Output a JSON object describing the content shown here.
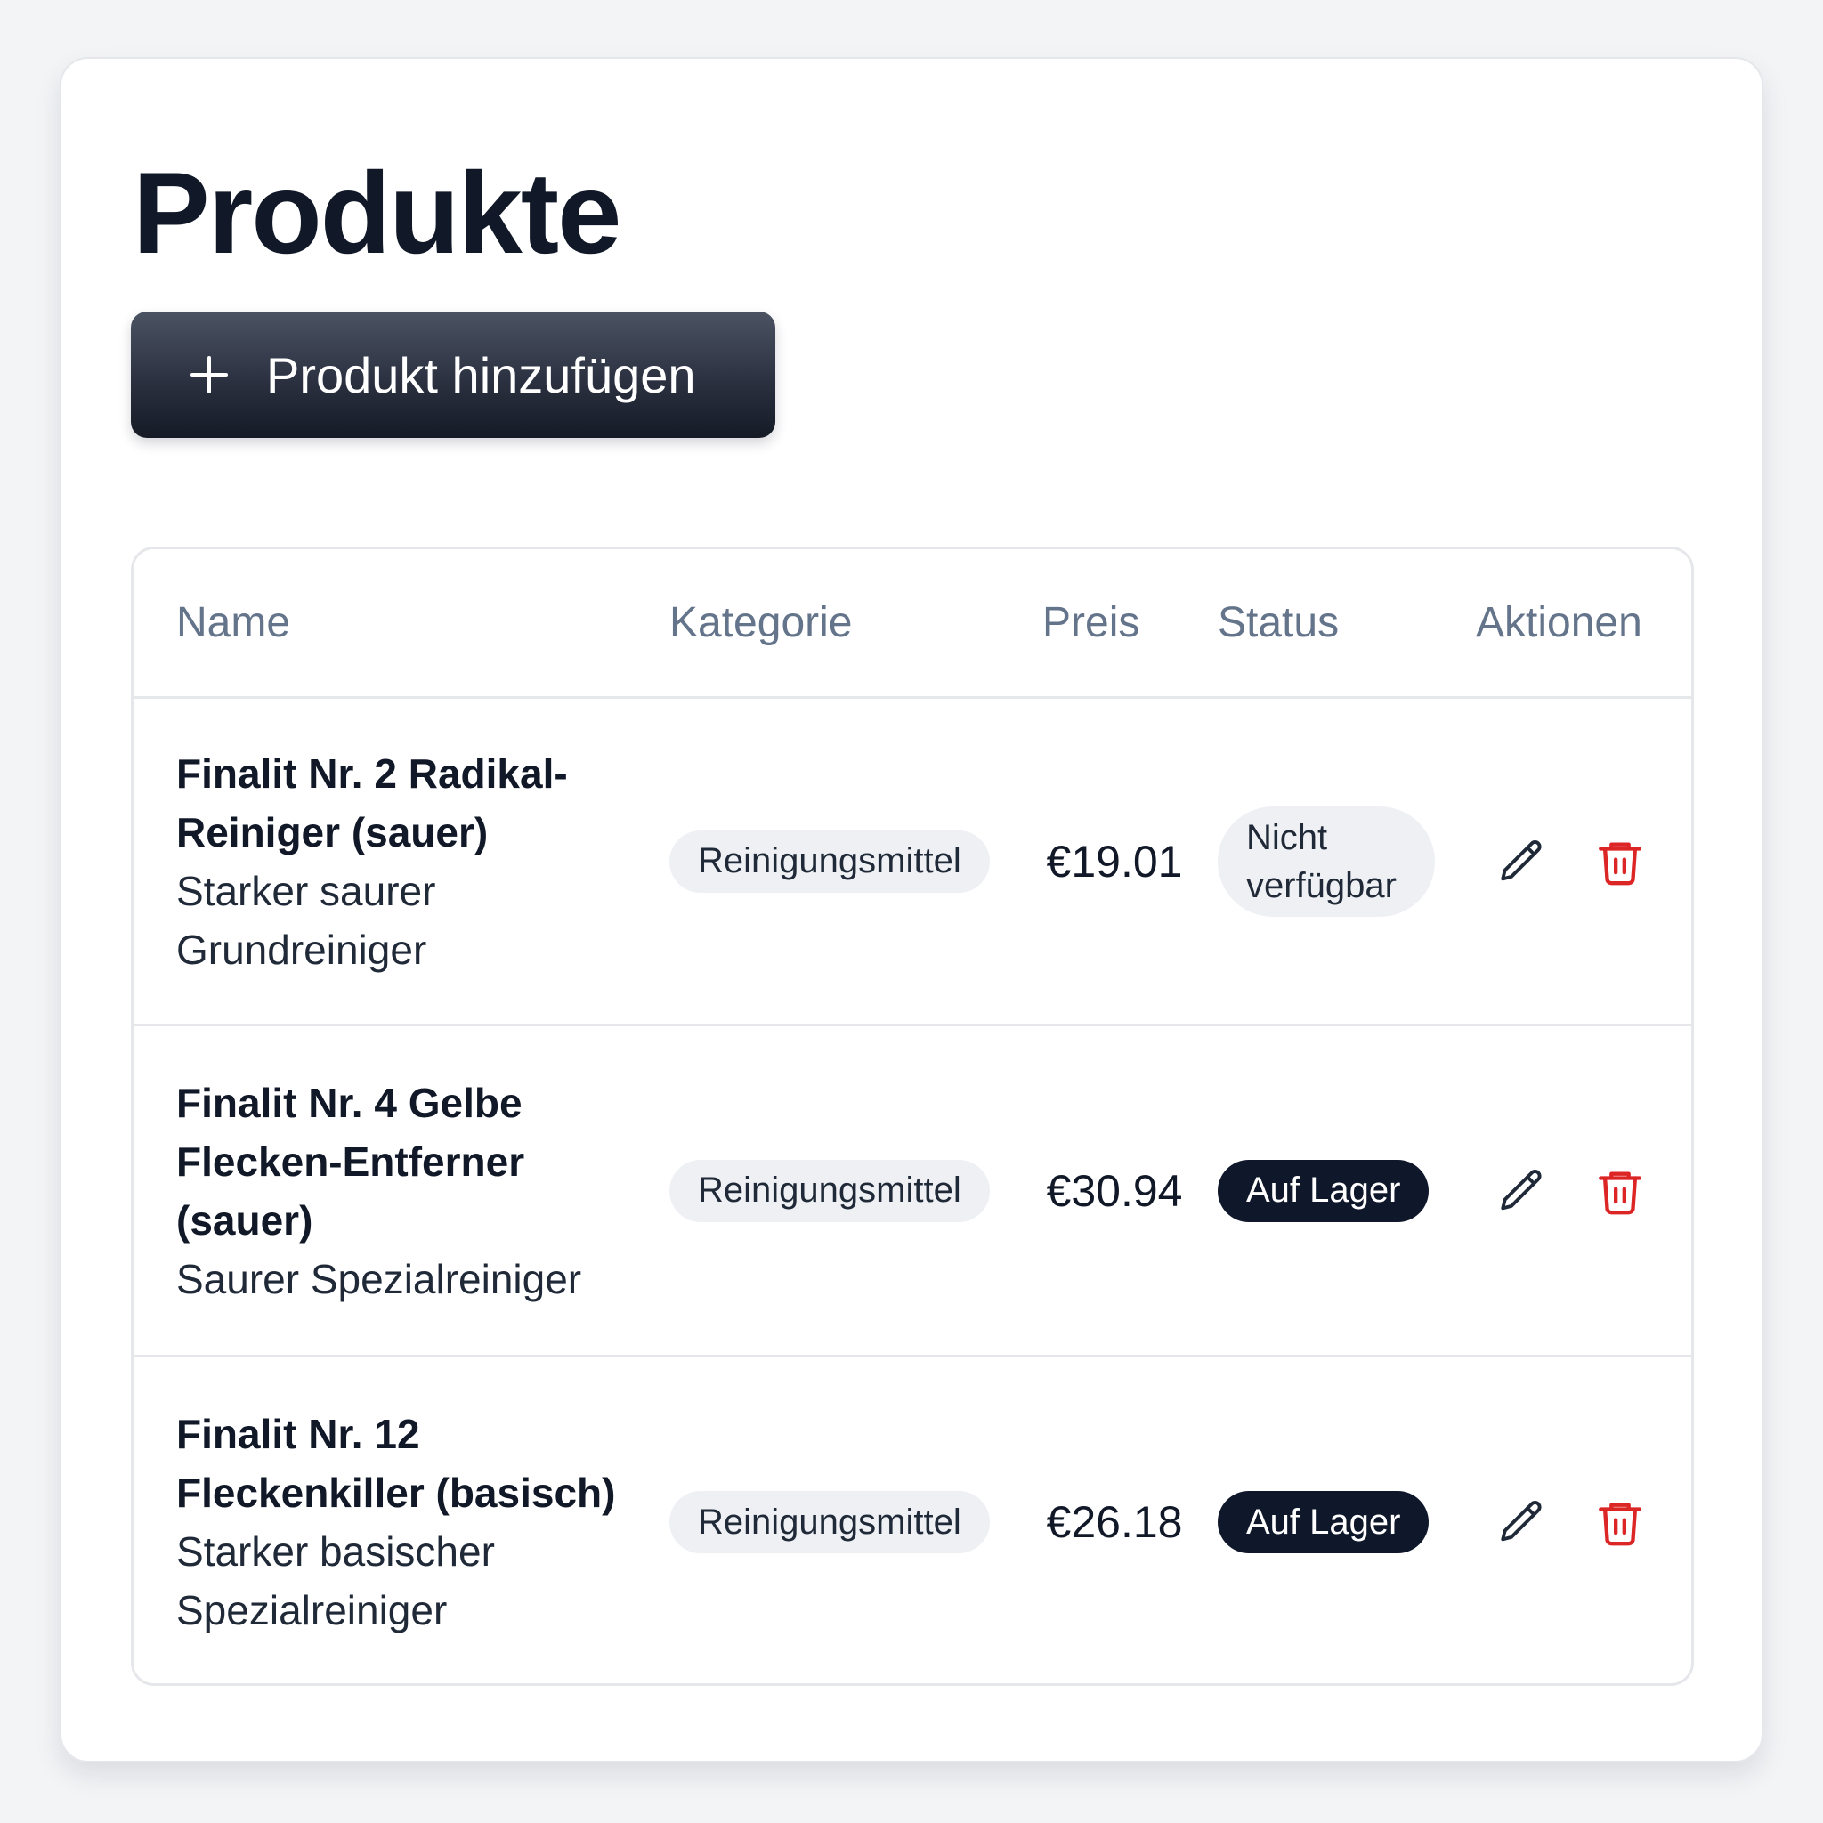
{
  "page": {
    "title": "Produkte"
  },
  "toolbar": {
    "add_label": "Produkt hinzufügen",
    "add_icon": "plus-icon"
  },
  "table": {
    "columns": [
      "Name",
      "Kategorie",
      "Preis",
      "Status",
      "Aktionen"
    ],
    "rows": [
      {
        "name": "Finalit Nr. 2 Radikal-Reiniger (sauer)",
        "description": "Starker saurer Grundreiniger",
        "category": "Reinigungsmittel",
        "price": "€19.01",
        "status": "Nicht verfügbar",
        "status_variant": "unavailable"
      },
      {
        "name": "Finalit Nr. 4 Gelbe Flecken-Entferner (sauer)",
        "description": "Saurer Spezialreiniger",
        "category": "Reinigungsmittel",
        "price": "€30.94",
        "status": "Auf Lager",
        "status_variant": "in-stock"
      },
      {
        "name": "Finalit Nr. 12 Fleckenkiller (basisch)",
        "description": "Starker basischer Spezialreiniger",
        "category": "Reinigungsmittel",
        "price": "€26.18",
        "status": "Auf Lager",
        "status_variant": "in-stock"
      }
    ],
    "actions": {
      "edit_icon": "pencil-icon",
      "delete_icon": "trash-icon"
    }
  },
  "colors": {
    "accent_dark": "#0f172a",
    "delete_red": "#dc2626",
    "pill_gray": "#eef0f4",
    "header_text": "#64748b"
  }
}
